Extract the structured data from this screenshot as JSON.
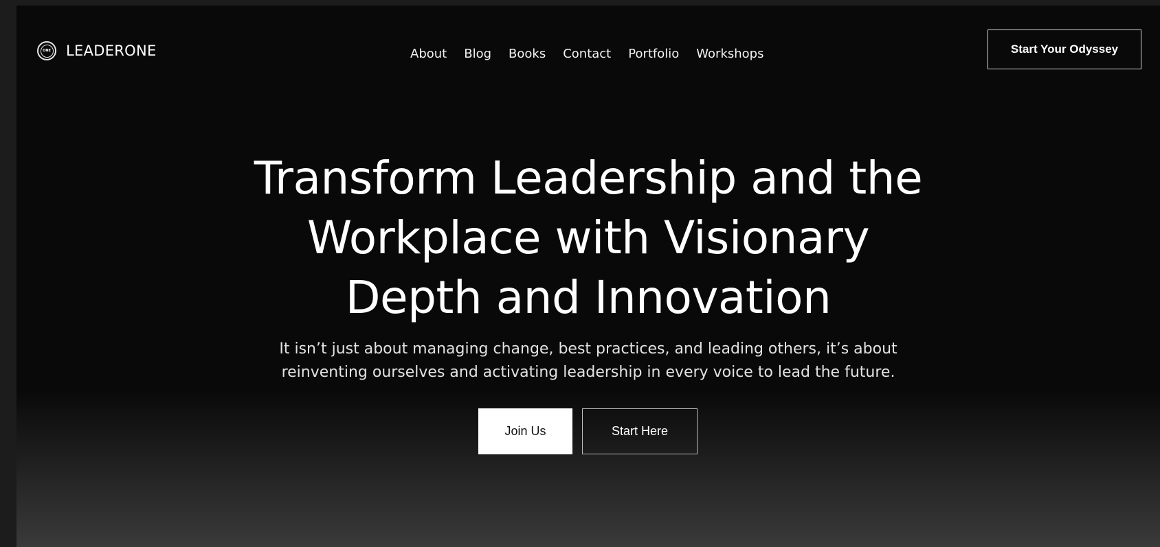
{
  "header": {
    "logo_icon_text": "ONE",
    "logo_text": "LEADERONE",
    "nav": [
      {
        "label": "About"
      },
      {
        "label": "Blog"
      },
      {
        "label": "Books"
      },
      {
        "label": "Contact"
      },
      {
        "label": "Portfolio"
      },
      {
        "label": "Workshops"
      }
    ],
    "cta_label": "Start Your Odyssey"
  },
  "hero": {
    "title_line1": "Transform Leadership and the",
    "title_line2": "Workplace with Visionary",
    "title_line3": "Depth and Innovation",
    "subtitle_line1": "It isn’t just about managing change, best practices, and leading others, it’s about",
    "subtitle_line2": "reinventing ourselves and activating leadership in every voice to lead the future.",
    "primary_button": "Join Us",
    "secondary_button": "Start Here"
  },
  "colors": {
    "background": "#090909",
    "text": "#ffffff",
    "primary_button_bg": "#ffffff"
  }
}
